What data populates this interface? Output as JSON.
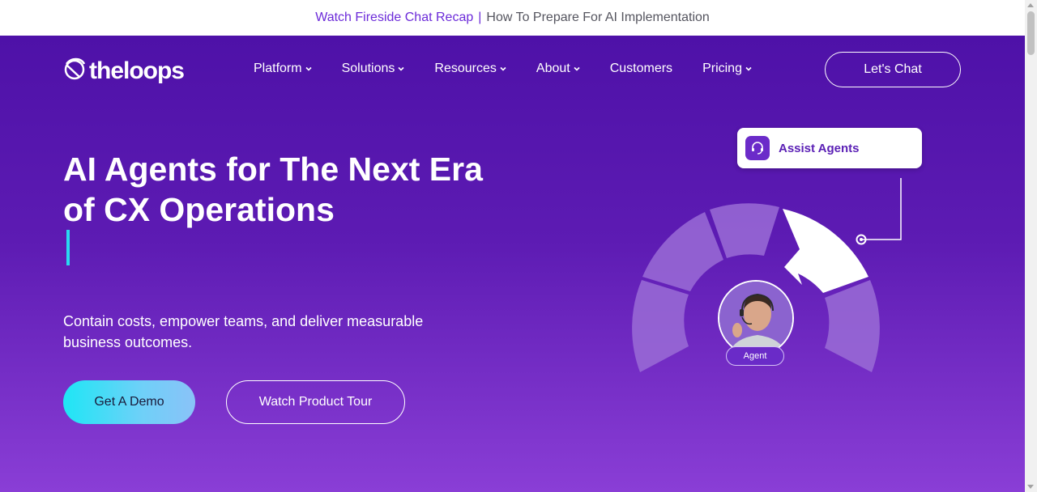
{
  "announcement": {
    "link_text": "Watch Fireside Chat Recap",
    "separator": "|",
    "text": "How To Prepare For AI Implementation"
  },
  "brand": {
    "logo_text": "theloops"
  },
  "nav": {
    "items": [
      {
        "label": "Platform",
        "has_dropdown": true
      },
      {
        "label": "Solutions",
        "has_dropdown": true
      },
      {
        "label": "Resources",
        "has_dropdown": true
      },
      {
        "label": "About",
        "has_dropdown": true
      },
      {
        "label": "Customers",
        "has_dropdown": false
      },
      {
        "label": "Pricing",
        "has_dropdown": true
      }
    ],
    "cta_label": "Let's Chat"
  },
  "hero": {
    "headline_line1": "AI Agents for The Next Era",
    "headline_line2": "of CX Operations",
    "subtext_line1": "Contain costs, empower teams, and deliver measurable",
    "subtext_line2": "business outcomes.",
    "primary_button": "Get A Demo",
    "secondary_button": "Watch Product Tour"
  },
  "illustration": {
    "card_label": "Assist Agents",
    "card_icon": "headset-icon",
    "avatar_label": "Agent"
  },
  "colors": {
    "hero_top": "#4e11a8",
    "hero_bottom": "#8a3ed6",
    "accent_link": "#6c2bd9",
    "cursor": "#2ad9f0",
    "demo_gradient_start": "#1ee6f5"
  }
}
